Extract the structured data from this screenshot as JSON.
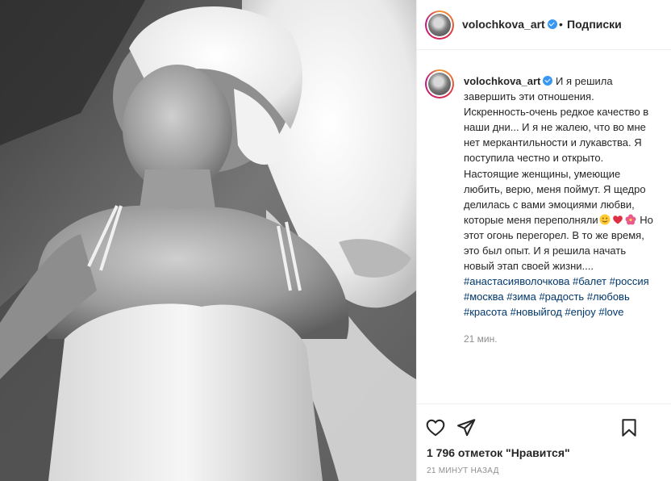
{
  "post": {
    "username": "volochkova_art",
    "verified": true,
    "separator": "•",
    "follow_label": "Подписки",
    "more_label": "•••",
    "caption": {
      "username": "volochkova_art",
      "text_before_emoji": "И я решила завершить эти отношения. Искренность-очень редкое качество в наши дни... И я не жалею, что во мне нет меркантильности и лукавства. Я поступила честно и открыто. Настоящие женщины, умеющие любить, верю, меня поймут. Я щедро делилась с вами эмоциями любви, которые меня переполняли",
      "emojis": [
        "smiling-face",
        "red-heart",
        "hibiscus"
      ],
      "text_after_emoji": " Но этот огонь перегорел. В то же время, это был опыт. И я решила начать новый этап своей жизни.... ",
      "hashtags": [
        "#анастасияволочкова",
        "#балет",
        "#россия",
        "#москва",
        "#зима",
        "#радость",
        "#любовь",
        "#красота",
        "#новыйгод",
        "#enjoy",
        "#love"
      ]
    },
    "caption_time": "21 мин.",
    "likes_text": "1 796 отметок \"Нравится\"",
    "date_text": "21 МИНУТ НАЗАД"
  },
  "icons": {
    "like": "heart-outline-icon",
    "share": "paper-plane-icon",
    "save": "bookmark-icon",
    "verified": "verified-badge-icon"
  },
  "colors": {
    "text": "#262626",
    "secondary": "#8e8e8e",
    "hashtag": "#00376b",
    "verified": "#3897f0",
    "border": "#efefef"
  }
}
